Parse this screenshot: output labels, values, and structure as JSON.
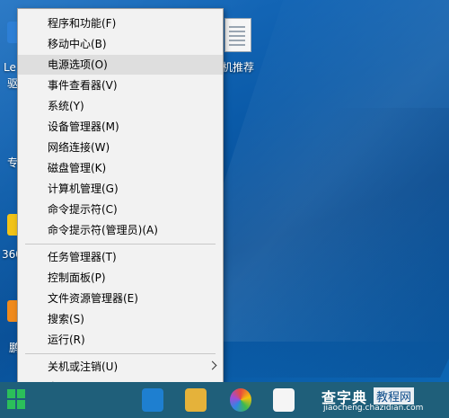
{
  "desktop": {
    "left_labels": [
      "Le",
      "驱",
      "专",
      "360",
      "鹏"
    ],
    "doc_label": "机推荐"
  },
  "menu": {
    "highlighted_index": 2,
    "items": [
      {
        "label": "程序和功能(F)"
      },
      {
        "label": "移动中心(B)"
      },
      {
        "label": "电源选项(O)"
      },
      {
        "label": "事件查看器(V)"
      },
      {
        "label": "系统(Y)"
      },
      {
        "label": "设备管理器(M)"
      },
      {
        "label": "网络连接(W)"
      },
      {
        "label": "磁盘管理(K)"
      },
      {
        "label": "计算机管理(G)"
      },
      {
        "label": "命令提示符(C)"
      },
      {
        "label": "命令提示符(管理员)(A)"
      },
      {
        "label": "任务管理器(T)"
      },
      {
        "label": "控制面板(P)"
      },
      {
        "label": "文件资源管理器(E)"
      },
      {
        "label": "搜索(S)"
      },
      {
        "label": "运行(R)"
      },
      {
        "label": "关机或注销(U)",
        "submenu": true
      },
      {
        "label": "桌面(D)"
      }
    ]
  },
  "watermark": {
    "main": "查字典",
    "tail": "教程网",
    "url": "jiaocheng.chazidian.com"
  },
  "colors": {
    "start_green": "#2bbf5a",
    "taskbar": "#1f5f7a",
    "menu_bg": "#f2f2f2",
    "highlight": "#dedede"
  }
}
